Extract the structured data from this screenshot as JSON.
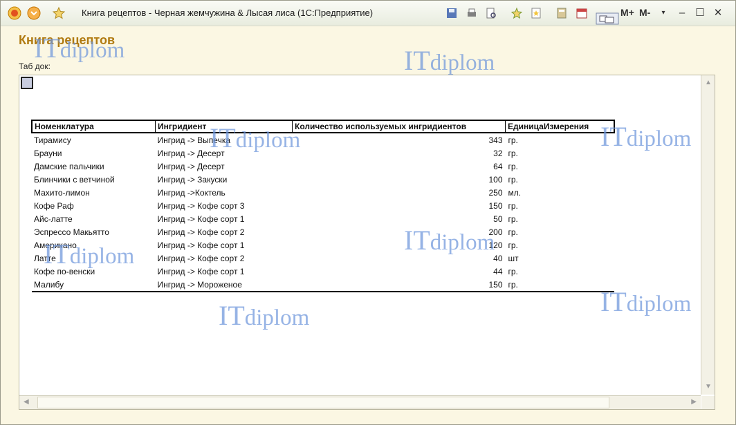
{
  "window": {
    "title": "Книга рецептов - Черная жемчужина & Лысая лиса  (1С:Предприятие)"
  },
  "form": {
    "title": "Книга рецептов",
    "doc_label": "Таб док:"
  },
  "toolbar": {
    "m_plus": "M+",
    "m_minus": "M-"
  },
  "table": {
    "headers": [
      "Номенклатура",
      "Ингридиент",
      "Количество используемых ингридиентов",
      "ЕдиницаИзмерения"
    ],
    "rows": [
      [
        "Тирамису",
        "Ингрид -> Выпечка",
        "343",
        "гр."
      ],
      [
        "Брауни",
        "Ингрид -> Десерт",
        "32",
        "гр."
      ],
      [
        "Дамские пальчики",
        "Ингрид -> Десерт",
        "64",
        "гр."
      ],
      [
        "Блинчики с ветчиной",
        "Ингрид -> Закуски",
        "100",
        "гр."
      ],
      [
        "Махито-лимон",
        "Ингрид ->Коктель",
        "250",
        "мл."
      ],
      [
        "Кофе Раф",
        "Ингрид -> Кофе сорт 3",
        "150",
        "гр."
      ],
      [
        "Айс-латте",
        "Ингрид -> Кофе сорт 1",
        "50",
        "гр."
      ],
      [
        "Эспрессо Макьятто",
        "Ингрид -> Кофе сорт 2",
        "200",
        "гр."
      ],
      [
        "Американо",
        "Ингрид -> Кофе сорт 1",
        "120",
        "гр."
      ],
      [
        "Латте",
        "Ингрид -> Кофе сорт 2",
        "40",
        "шт"
      ],
      [
        "Кофе по-венски",
        "Ингрид -> Кофе сорт 1",
        "44",
        "гр."
      ],
      [
        "Малибу",
        "Ингрид -> Мороженое",
        "150",
        "гр."
      ]
    ]
  },
  "watermark": {
    "prefix": "IT",
    "suffix": "diplom"
  },
  "colors": {
    "title": "#b07a10",
    "watermark": "#6f97dc",
    "background": "#fbf7e3"
  }
}
